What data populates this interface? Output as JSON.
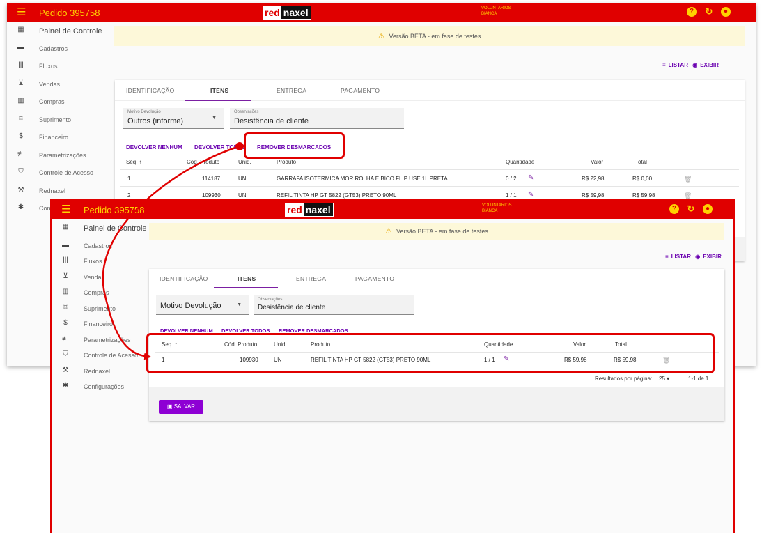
{
  "header": {
    "title": "Pedido 395758",
    "logo_left": "red",
    "logo_right": "naxel",
    "org_line1": "VOLUNTARIOS",
    "org_line2": "BIANCA",
    "help_icon": "question-circle-icon",
    "refresh_icon": "refresh-icon",
    "user_icon": "account-circle-icon"
  },
  "sidebar": {
    "items": [
      {
        "label": "Painel de Controle",
        "icon": "dashboard-icon"
      },
      {
        "label": "Cadastros",
        "icon": "folder-icon"
      },
      {
        "label": "Fluxos",
        "icon": "columns-icon"
      },
      {
        "label": "Vendas",
        "icon": "cart-icon"
      },
      {
        "label": "Compras",
        "icon": "building-icon"
      },
      {
        "label": "Suprimento",
        "icon": "target-icon"
      },
      {
        "label": "Financeiro",
        "icon": "money-icon"
      },
      {
        "label": "Parametrizações",
        "icon": "sliders-icon"
      },
      {
        "label": "Controle de Acesso",
        "icon": "shield-icon"
      },
      {
        "label": "Rednaxel",
        "icon": "wrench-icon"
      },
      {
        "label": "Configurações",
        "icon": "gear-icon"
      }
    ]
  },
  "banner": {
    "text": "Versão BETA - em fase de testes"
  },
  "view_actions": {
    "list": "LISTAR",
    "show": "EXIBIR"
  },
  "tabs": [
    "IDENTIFICAÇÃO",
    "ITENS",
    "ENTREGA",
    "PAGAMENTO"
  ],
  "form": {
    "motivo_label": "Motivo Devolução",
    "motivo_value": "Outros (informe)",
    "obs_label": "Observações",
    "obs_value": "Desistência de cliente"
  },
  "actions": {
    "none": "DEVOLVER NENHUM",
    "all": "DEVOLVER TODOS",
    "remove": "REMOVER DESMARCADOS"
  },
  "table": {
    "headers": [
      "Seq. ↑",
      "Cód. Produto",
      "Unid.",
      "Produto",
      "Quantidade",
      "Valor",
      "Total"
    ],
    "rows_before": [
      {
        "seq": "1",
        "code": "114187",
        "unit": "UN",
        "product": "GARRAFA ISOTERMICA MOR ROLHA E BICO FLIP USE 1L PRETA",
        "qty": "0 / 2",
        "value": "R$ 22,98",
        "total": "R$ 0,00"
      },
      {
        "seq": "2",
        "code": "109930",
        "unit": "UN",
        "product": "REFIL TINTA HP GT 5822 (GT53) PRETO 90ML",
        "qty": "1 / 1",
        "value": "R$ 59,98",
        "total": "R$ 59,98"
      }
    ],
    "rows_after": [
      {
        "seq": "1",
        "code": "109930",
        "unit": "UN",
        "product": "REFIL TINTA HP GT 5822 (GT53) PRETO 90ML",
        "qty": "1 / 1",
        "value": "R$ 59,98",
        "total": "R$ 59,98"
      }
    ]
  },
  "pagination": {
    "label": "Resultados por página:",
    "size": "25",
    "range": "1-1 de 1"
  },
  "save_label": "SALVAR",
  "colors": {
    "primary_red": "#e00000",
    "accent_yellow": "#ffd200",
    "purple": "#7b1fa2"
  }
}
